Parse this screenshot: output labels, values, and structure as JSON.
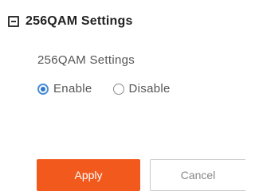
{
  "section": {
    "title": "256QAM Settings"
  },
  "field": {
    "label": "256QAM Settings",
    "options": [
      {
        "label": "Enable",
        "selected": true
      },
      {
        "label": "Disable",
        "selected": false
      }
    ]
  },
  "buttons": {
    "apply_label": "Apply",
    "cancel_label": "Cancel"
  },
  "colors": {
    "apply_bg": "#f25a1d",
    "radio_accent": "#2f78c7"
  }
}
